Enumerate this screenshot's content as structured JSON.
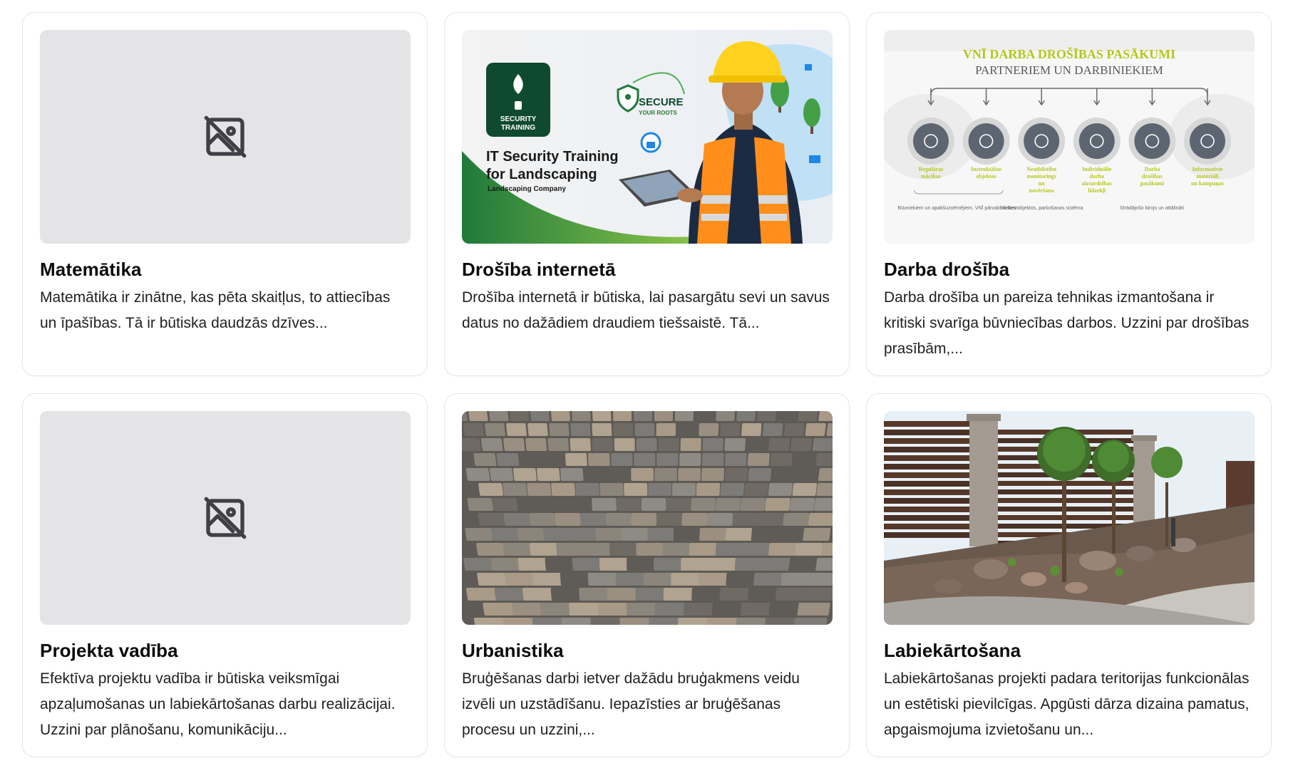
{
  "cards": [
    {
      "title": "Matemātika",
      "description": "Matemātika ir zinātne, kas pēta skaitļus, to attiecības un īpašības. Tā ir būtiska daudzās dzīves...",
      "image": "placeholder"
    },
    {
      "title": "Drošība internetā",
      "description": "Drošība internetā ir būtiska, lai pasargātu sevi un savus datus no dažādiem draudiem tiešsaistē. Tā...",
      "image": "it-security-banner",
      "banner": {
        "badge_line1": "SECURITY",
        "badge_line2": "TRAINING",
        "headline1": "IT Security Training",
        "headline2": "for Landscaping",
        "company": "Landscaping Company",
        "secure": "SECURE",
        "secure_sub": "YOUR ROOTS"
      }
    },
    {
      "title": "Darba drošība",
      "description": "Darba drošība un pareiza tehnikas izmantošana ir kritiski svarīga būvniecības darbos. Uzzini par drošības prasībām,...",
      "image": "infographic",
      "infographic": {
        "heading1": "VNĪ DARBA DROŠĪBAS PASĀKUMI",
        "heading2": "PARTNERIEM UN DARBINIEKIEM",
        "items": [
          "Regulāras mācības",
          "Instruktāžas objektos",
          "Neatbilstību monitorings un novēršana",
          "Individuālie darba aizsardzības līdzekļi",
          "Darba drošības pasākumi",
          "Informatīvie materiāli un kampaņas"
        ],
        "note1": "Būvniekiem un apakšuzņēmējiem, VNĪ pārvaldniekiem",
        "note2": "Vizītes objektos, parkošanas sistēma",
        "note3": "Strādājošo birojs un attālināti"
      }
    },
    {
      "title": "Projekta vadība",
      "description": "Efektīva projektu vadība ir būtiska veiksmīgai apzaļumošanas un labiekārtošanas darbu realizācijai. Uzzini par plānošanu, komunikāciju...",
      "image": "placeholder"
    },
    {
      "title": "Urbanistika",
      "description": "Bruģēšanas darbi ietver dažādu bruģakmens veidu izvēli un uzstādīšanu. Iepazīsties ar bruģēšanas procesu un uzzini,...",
      "image": "paving-stones"
    },
    {
      "title": "Labiekārtošana",
      "description": "Labiekārtošanas projekti padara teritorijas funkcionālas un estētiski pievilcīgas. Apgūsti dārza dizaina pamatus, apgaismojuma izvietošanu un...",
      "image": "garden"
    }
  ],
  "colors": {
    "card_border": "#e6e6e6",
    "placeholder_bg": "#e4e4e7",
    "placeholder_icon": "#3f3f46",
    "infographic_green": "#b5c81a"
  }
}
